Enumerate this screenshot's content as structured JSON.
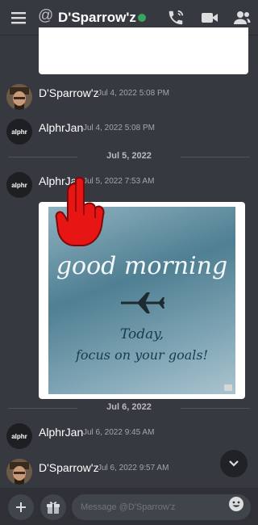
{
  "header": {
    "at_sign": "@",
    "title": "D'Sparrow'z"
  },
  "messages": [
    {
      "author": "D'Sparrow'z",
      "time": "Jul 4, 2022 5:08 PM"
    },
    {
      "author": "AlphrJan",
      "time": "Jul 4, 2022 5:08 PM"
    },
    {
      "author": "AlphrJan",
      "time": "Jul 5, 2022 7:53 AM"
    },
    {
      "author": "AlphrJan",
      "time": "Jul 6, 2022 9:45 AM"
    },
    {
      "author": "D'Sparrow'z",
      "time": "Jul 6, 2022 9:57 AM"
    }
  ],
  "dividers": [
    "Jul 5, 2022",
    "Jul 6, 2022"
  ],
  "image": {
    "line1": "good morning",
    "line2": "Today,",
    "line3": "focus on your goals!"
  },
  "avatar_text": "alphr",
  "composer": {
    "placeholder": "Message @D'Sparrow'z"
  }
}
